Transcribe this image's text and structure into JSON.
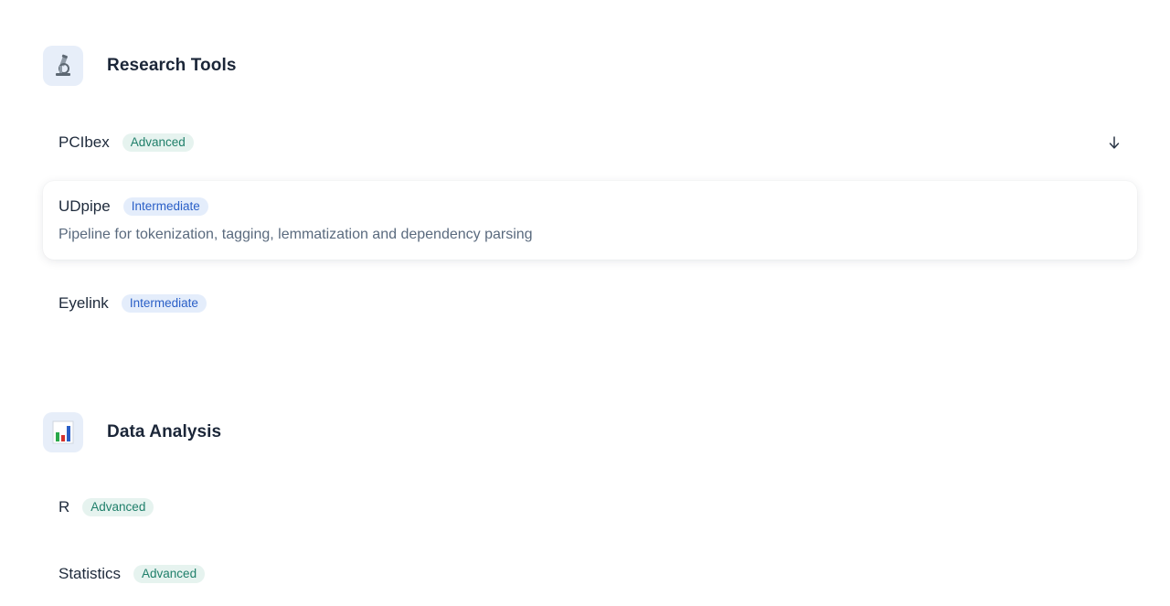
{
  "sections": [
    {
      "title": "Research Tools",
      "icon": "microscope-icon",
      "items": [
        {
          "name": "PCIbex",
          "level": "Advanced"
        },
        {
          "name": "UDpipe",
          "level": "Intermediate",
          "description": "Pipeline for tokenization, tagging, lemmatization and dependency parsing"
        },
        {
          "name": "Eyelink",
          "level": "Intermediate"
        }
      ]
    },
    {
      "title": "Data Analysis",
      "icon": "bar-chart-icon",
      "items": [
        {
          "name": "R",
          "level": "Advanced"
        },
        {
          "name": "Statistics",
          "level": "Advanced"
        }
      ]
    }
  ],
  "colors": {
    "advanced_badge_bg": "#e6f3ef",
    "advanced_badge_text": "#1f7f6a",
    "intermediate_badge_bg": "#e4edfb",
    "intermediate_badge_text": "#2a5fc7",
    "icon_tile_bg": "#e7eef9"
  }
}
